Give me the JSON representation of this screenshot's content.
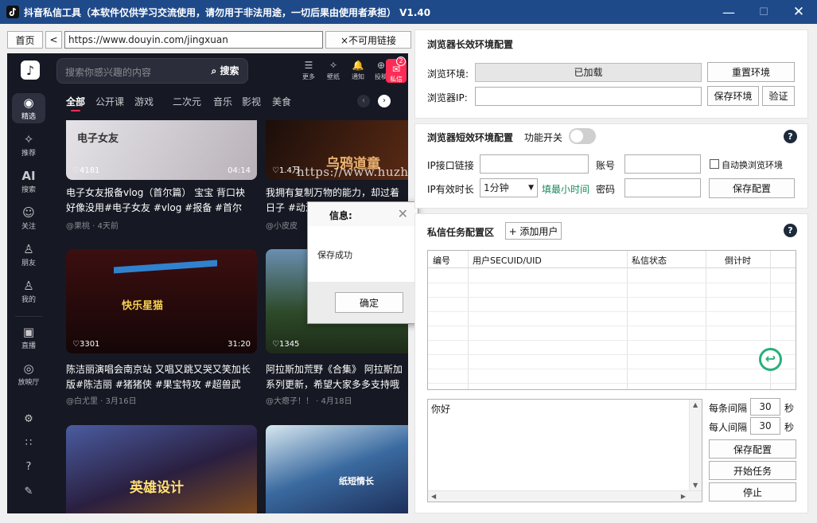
{
  "window": {
    "title": "抖音私信工具（本软件仅供学习交流使用，请勿用于非法用途，一切后果由使用者承担） V1.40",
    "minimize": "—",
    "maximize": "☐",
    "close": "✕"
  },
  "browser": {
    "home_label": "首页",
    "back_label": "<",
    "url": "https://www.douyin.com/jingxuan",
    "unavailable_label": "×不可用链接"
  },
  "douyin": {
    "search_placeholder": "搜索你感兴趣的内容",
    "search_button": "搜索",
    "top_icons": [
      {
        "icon": "menu-icon",
        "glyph": "☰",
        "label": "更多"
      },
      {
        "icon": "wallpaper-icon",
        "glyph": "✧",
        "label": "壁纸"
      },
      {
        "icon": "bell-icon",
        "glyph": "🔔",
        "label": "通知"
      },
      {
        "icon": "upload-icon",
        "glyph": "⊕",
        "label": "投稿"
      }
    ],
    "message": {
      "label": "私信",
      "count": "2"
    },
    "sidebar": [
      {
        "icon": "featured-icon",
        "glyph": "◉",
        "label": "精选"
      },
      {
        "icon": "recommend-icon",
        "glyph": "✧",
        "label": "推荐"
      },
      {
        "icon": "ai-search-icon",
        "glyph": "AI",
        "label": "搜索"
      },
      {
        "icon": "follow-icon",
        "glyph": "☺",
        "label": "关注"
      },
      {
        "icon": "friends-icon",
        "glyph": "♙",
        "label": "朋友"
      },
      {
        "icon": "me-icon",
        "glyph": "♙",
        "label": "我的"
      },
      {
        "icon": "live-icon",
        "glyph": "▣",
        "label": "直播"
      },
      {
        "icon": "screening-room-icon",
        "glyph": "◎",
        "label": "放映厅"
      }
    ],
    "sidebar_bottom": [
      {
        "icon": "settings-icon",
        "glyph": "⚙"
      },
      {
        "icon": "apps-icon",
        "glyph": "∷"
      },
      {
        "icon": "help-icon",
        "glyph": "?"
      },
      {
        "icon": "feedback-icon",
        "glyph": "✎"
      }
    ],
    "categories": [
      "全部",
      "公开课",
      "游戏",
      "二次元",
      "音乐",
      "影视",
      "美食"
    ],
    "cards": [
      {
        "likes": "♡4181",
        "duration": "04:14",
        "title": "电子女友报备vlog（首尔篇） 宝宝 背口袂 好像没用#电子女友 #vlog #报备 #首尔",
        "meta": "@果桃 · 4天前",
        "img_text": "电子女友",
        "bg": "#d9d6dc"
      },
      {
        "likes": "♡1.4万",
        "duration": "",
        "title": "我拥有复制万物的能力，却过着 日子 #动漫解说",
        "meta": "@小皮皮",
        "img_text": "乌鸦道童",
        "bg": "#3a1b12"
      },
      {
        "likes": "♡3301",
        "duration": "31:20",
        "title": "陈洁丽演唱会南京站 又唱又跳又哭又笑加长版#陈洁丽 #猪猪侠 #果宝特攻 #超兽武装…",
        "meta": "@白尤里 · 3月16日",
        "img_text": "快乐星猫",
        "bg": "#3a1010"
      },
      {
        "likes": "♡1345",
        "duration": "",
        "title": "阿拉斯加荒野《合集》 阿拉斯加 系列更新，希望大家多多支持哦",
        "meta": "@大瘪子！！ · 4月18日",
        "img_text": "",
        "bg": "#3b5a3a"
      },
      {
        "likes": "",
        "duration": "",
        "title": "",
        "meta": "",
        "img_text": "英雄设计",
        "bg": "#2a2f55"
      },
      {
        "likes": "",
        "duration": "",
        "title": "",
        "meta": "",
        "img_text": "纸短情长",
        "bg": "#2b4a7a"
      }
    ]
  },
  "watermark": "https://www.huzhan.com/ishop54875",
  "dialog": {
    "title": "信息:",
    "close": "✕",
    "message": "保存成功",
    "ok_label": "确定"
  },
  "long_env": {
    "title": "浏览器长效环境配置",
    "env_label": "浏览环境:",
    "env_value": "已加载",
    "reset_label": "重置环境",
    "ip_label": "浏览器IP:",
    "save_env_label": "保存环境",
    "verify_label": "验证"
  },
  "short_env": {
    "title": "浏览器短效环境配置",
    "feature_switch_label": "功能开关",
    "ip_api_label": "IP接口链接",
    "account_label": "账号",
    "auto_switch_label": "自动换浏览环境",
    "ip_valid_label": "IP有效时长",
    "ip_valid_value": "1分钟",
    "min_time_link": "填最小时间",
    "password_label": "密码",
    "save_config_label": "保存配置"
  },
  "dm_task": {
    "title": "私信任务配置区",
    "add_user_label": "+ 添加用户",
    "columns": [
      "编号",
      "用户SECUID/UID",
      "私信状态",
      "倒计时"
    ],
    "message_text": "你好",
    "interval_each_label": "每条间隔",
    "interval_each_value": "30",
    "interval_user_label": "每人间隔",
    "interval_user_value": "30",
    "seconds_unit": "秒",
    "save_config_label": "保存配置",
    "start_label": "开始任务",
    "stop_label": "停止"
  },
  "colors": {
    "titlebar": "#1f4a8a",
    "douyin_bg": "#161823",
    "douyin_accent": "#fe2c55",
    "link_green": "#1a8a5a",
    "help_icon": "#1d2a3b"
  }
}
